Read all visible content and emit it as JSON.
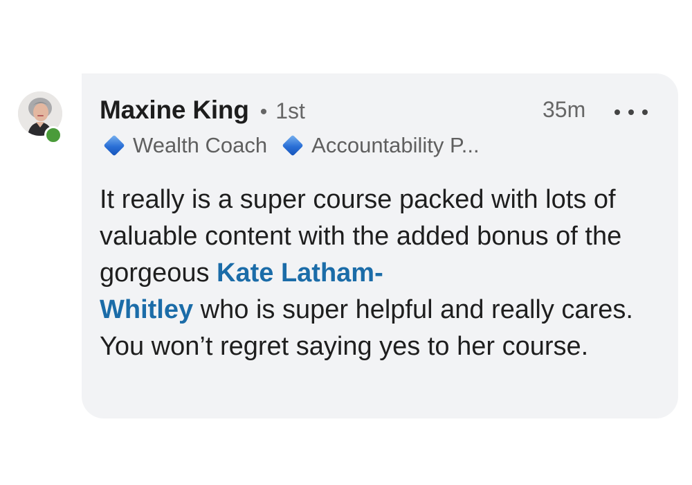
{
  "comment": {
    "author": {
      "name": "Maxine King",
      "separator": "•",
      "degree": "1st",
      "headline": [
        "Wealth Coach",
        "Accountability P..."
      ],
      "online": true
    },
    "time": "35m",
    "body": {
      "part1": "It really is a super course packed with lots of valuable content with the added bonus of the gorgeous ",
      "mention_line1": "Kate Latham-",
      "mention_line2": "Whitley",
      "part2": " who is super helpful and really cares.   You won’t regret saying yes to her course."
    }
  },
  "icons": {
    "headline_marker": "blue-diamond-icon",
    "more": "more-horizontal-icon",
    "presence": "online-status-icon"
  },
  "colors": {
    "bubble_bg": "#f2f3f5",
    "mention": "#1b6ca8",
    "online": "#4a9b3a",
    "diamond": "#2a6fd6"
  }
}
